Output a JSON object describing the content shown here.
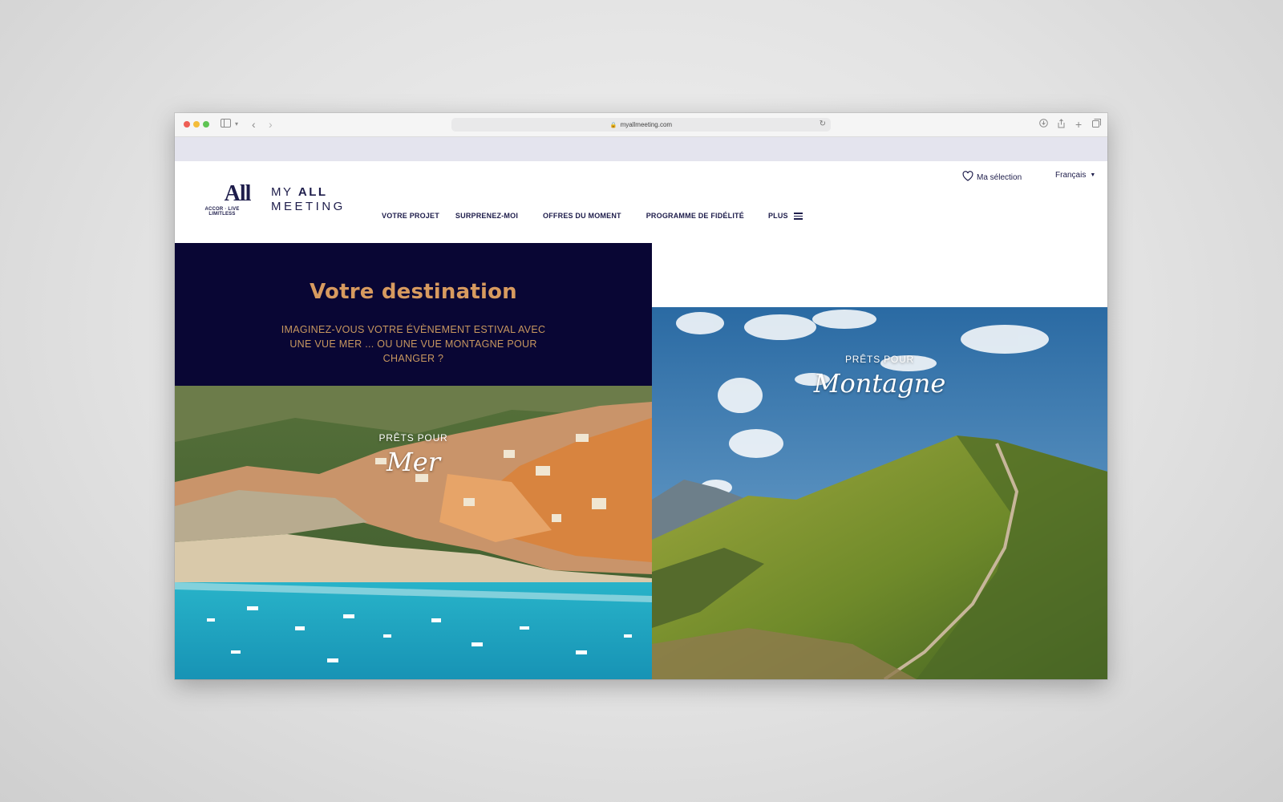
{
  "browser": {
    "url": "myallmeeting.com",
    "icons": [
      "sidebar-icon",
      "back-icon",
      "forward-icon",
      "download-icon",
      "share-icon",
      "new-tab-icon",
      "tabs-overview-icon"
    ]
  },
  "header": {
    "logo_text": "All",
    "logo_sub": "ACCOR · LIVE LIMITLESS",
    "brand_my": "MY",
    "brand_all": "ALL",
    "brand_meeting": "MEETING",
    "selection_label": "Ma sélection",
    "language": "Français",
    "nav": [
      {
        "label": "VOTRE PROJET"
      },
      {
        "label": "SURPRENEZ-MOI"
      },
      {
        "label": "OFFRES DU MOMENT"
      },
      {
        "label": "PROGRAMME DE FIDÉLITÉ"
      },
      {
        "label": "PLUS"
      }
    ]
  },
  "destination": {
    "title": "Votre destination",
    "subtitle": "IMAGINEZ-VOUS VOTRE ÉVÈNEMENT ESTIVAL AVEC UNE VUE MER ... OU UNE VUE MONTAGNE POUR CHANGER ?"
  },
  "panels": {
    "mer": {
      "pre": "PRÊTS POUR",
      "title": "Mer"
    },
    "montagne": {
      "pre": "PRÊTS POUR",
      "title": "Montagne"
    }
  },
  "colors": {
    "navy": "#090634",
    "brand_text": "#1e1d4b",
    "gold": "#d79a5f"
  }
}
